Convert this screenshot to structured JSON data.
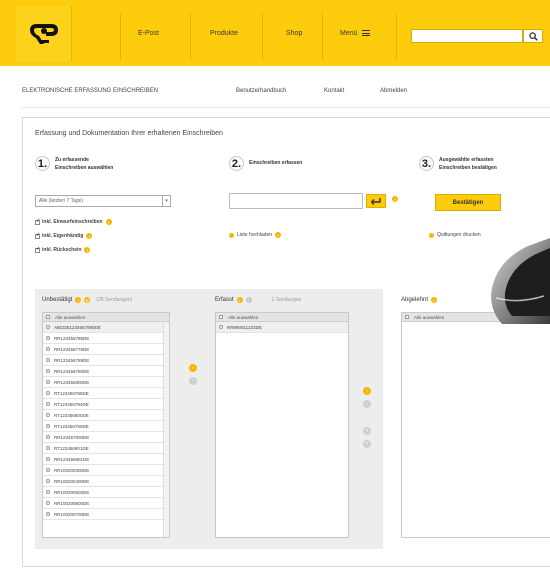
{
  "colors": {
    "brand_yellow": "#fdcc0d",
    "panel_gray": "#ededed",
    "accent": "#f5b800"
  },
  "header": {
    "logo_icon": "posthorn-icon",
    "nav": [
      "E-Post",
      "Produkte",
      "Shop",
      "Menü"
    ],
    "search_icon": "search-icon"
  },
  "subnav": {
    "title": "ELEKTRONISCHE ERFASSUNG EINSCHREIBEN",
    "links": [
      "Benutzerhandbuch",
      "Kontakt",
      "Abmelden"
    ]
  },
  "card": {
    "title": "Erfassung und Dokumentation Ihrer erhaltenen Einschreiben",
    "step1": {
      "num": "1.",
      "line1": "Zu erfassende",
      "line2": "Einschreiben auswählen"
    },
    "step2": {
      "num": "2.",
      "line1": "Einschreiben erfassen",
      "line2": ""
    },
    "step3": {
      "num": "3.",
      "line1": "Ausgewählte erfassten",
      "line2": "Einschreiben bestätigen"
    },
    "select_value": "Alle (letzten 7 Tage)",
    "checks": [
      "inkl. Einwurfeinschreiben",
      "inkl. Eigenhändig",
      "inkl. Rückschein"
    ],
    "link_liste": "Liste hochladen",
    "confirm_label": "Bestätigen",
    "link_quittung": "Quittungen drucken"
  },
  "panels": {
    "unbestaetigt": {
      "title": "Unbestätigt",
      "count": "(28 Sendungen)"
    },
    "erfasst": {
      "title": "Erfasst",
      "count": "1 Sendungen"
    },
    "abgelehnt": {
      "title": "Abgelehnt"
    },
    "select_all": "Alle auswählen"
  },
  "lists": {
    "unbestaetigt": [
      "ABCDE1234567890DE",
      "RR123456785DE",
      "RR123456776DE",
      "RR123456789DE",
      "RR123456790DE",
      "RR123456800DE",
      "RT123456785DE",
      "RT123456794DE",
      "RT123456800DE",
      "RT123456790DE",
      "RR123457000DE",
      "RT123456901DE",
      "RR123456901DE",
      "RR100200300DE",
      "RR100200400DE",
      "RR100200500DE",
      "RR100200600DE",
      "RR100200700DE"
    ],
    "erfasst": [
      "RR990011223DE"
    ]
  }
}
